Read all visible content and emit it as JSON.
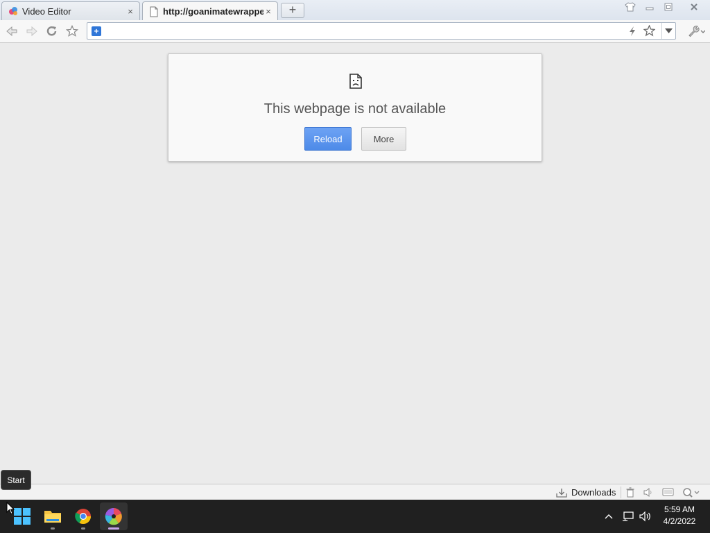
{
  "browser": {
    "tabs": [
      {
        "title": "Video Editor",
        "active": false,
        "icon": "video-editor-favicon"
      },
      {
        "title": "http://goanimatewrapper",
        "active": true,
        "icon": "page-favicon"
      }
    ],
    "new_tab_label": "+",
    "close_glyph": "×",
    "address_bar": {
      "value": "",
      "placeholder": ""
    }
  },
  "error_page": {
    "title": "This webpage is not available",
    "reload_label": "Reload",
    "more_label": "More"
  },
  "statusbar": {
    "downloads_label": "Downloads"
  },
  "tooltip": {
    "text": "Start"
  },
  "taskbar": {
    "apps": [
      "start-icon",
      "file-explorer-icon",
      "chrome-icon",
      "video-editor-icon"
    ],
    "time": "5:59 AM",
    "date": "4/2/2022"
  },
  "colors": {
    "reload_button": "#4d8ae8",
    "taskbar": "#202020",
    "page_background": "#ebebeb"
  }
}
